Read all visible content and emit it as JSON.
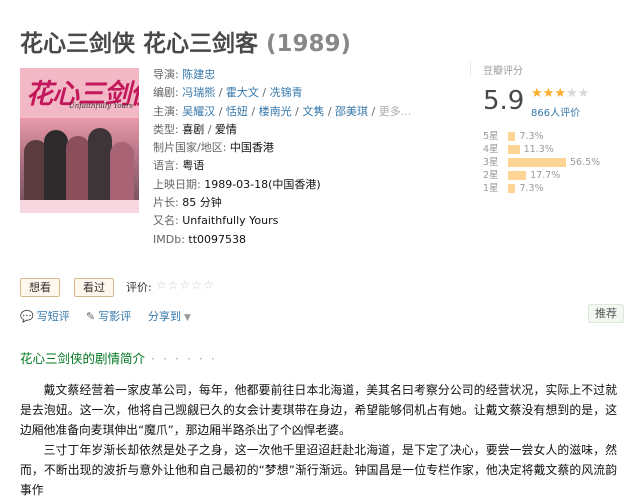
{
  "title": "花心三剑侠 花心三剑客",
  "year": "(1989)",
  "poster": {
    "title_text": "花心三剑侠",
    "subtitle_text": "Unfaithfully Yours"
  },
  "info": {
    "director_label": "导演:",
    "director": "陈建忠",
    "writer_label": "编剧:",
    "writers": [
      "冯瑞熊",
      "霍大文",
      "冼锦青"
    ],
    "cast_label": "主演:",
    "cast": [
      "吴耀汉",
      "恬妞",
      "楼南光",
      "文隽",
      "邵美琪"
    ],
    "cast_more": "更多...",
    "genre_label": "类型:",
    "genres": [
      "喜剧",
      "爱情"
    ],
    "country_label": "制片国家/地区:",
    "country": "中国香港",
    "language_label": "语言:",
    "language": "粤语",
    "release_label": "上映日期:",
    "release": "1989-03-18(中国香港)",
    "runtime_label": "片长:",
    "runtime": "85 分钟",
    "aka_label": "又名:",
    "aka": "Unfaithfully Yours",
    "imdb_label": "IMDb:",
    "imdb": "tt0097538",
    "separator": " / "
  },
  "rating": {
    "title": "豆瓣评分",
    "score": "5.9",
    "stars_filled": 3,
    "stars_total": 5,
    "votes": "866人评价",
    "distribution": [
      {
        "label": "5星",
        "pct_text": "7.3%",
        "pct": 7.3
      },
      {
        "label": "4星",
        "pct_text": "11.3%",
        "pct": 11.3
      },
      {
        "label": "3星",
        "pct_text": "56.5%",
        "pct": 56.5
      },
      {
        "label": "2星",
        "pct_text": "17.7%",
        "pct": 17.7
      },
      {
        "label": "1星",
        "pct_text": "7.3%",
        "pct": 7.3
      }
    ]
  },
  "actions": {
    "want": "想看",
    "watched": "看过",
    "rate_label": "评价:",
    "rate_stars": "☆☆☆☆☆"
  },
  "links": {
    "short_review": "写短评",
    "review": "写影评",
    "share": "分享到",
    "recommend": "推荐"
  },
  "section": {
    "title": "花心三剑侠的剧情简介",
    "dots": "· · · · · ·"
  },
  "synopsis": [
    "戴文蔡经营着一家皮革公司，每年，他都要前往日本北海道，美其名曰考察分公司的经营状况，实际上不过就是去泡妞。这一次，他将自己觊觎已久的女会计麦琪带在身边，希望能够伺机占有她。让戴文蔡没有想到的是，这边厢他准备向麦琪伸出“魔爪”，那边厢半路杀出了个凶悍老婆。",
    "三寸丁年岁渐长却依然是处子之身，这一次他千里迢迢赶赴北海道，是下定了决心，要尝一尝女人的滋味，然而，不断出现的波折与意外让他和自己最初的“梦想”渐行渐远。钟国昌是一位专栏作家，他决定将戴文蔡的风流韵事作"
  ]
}
